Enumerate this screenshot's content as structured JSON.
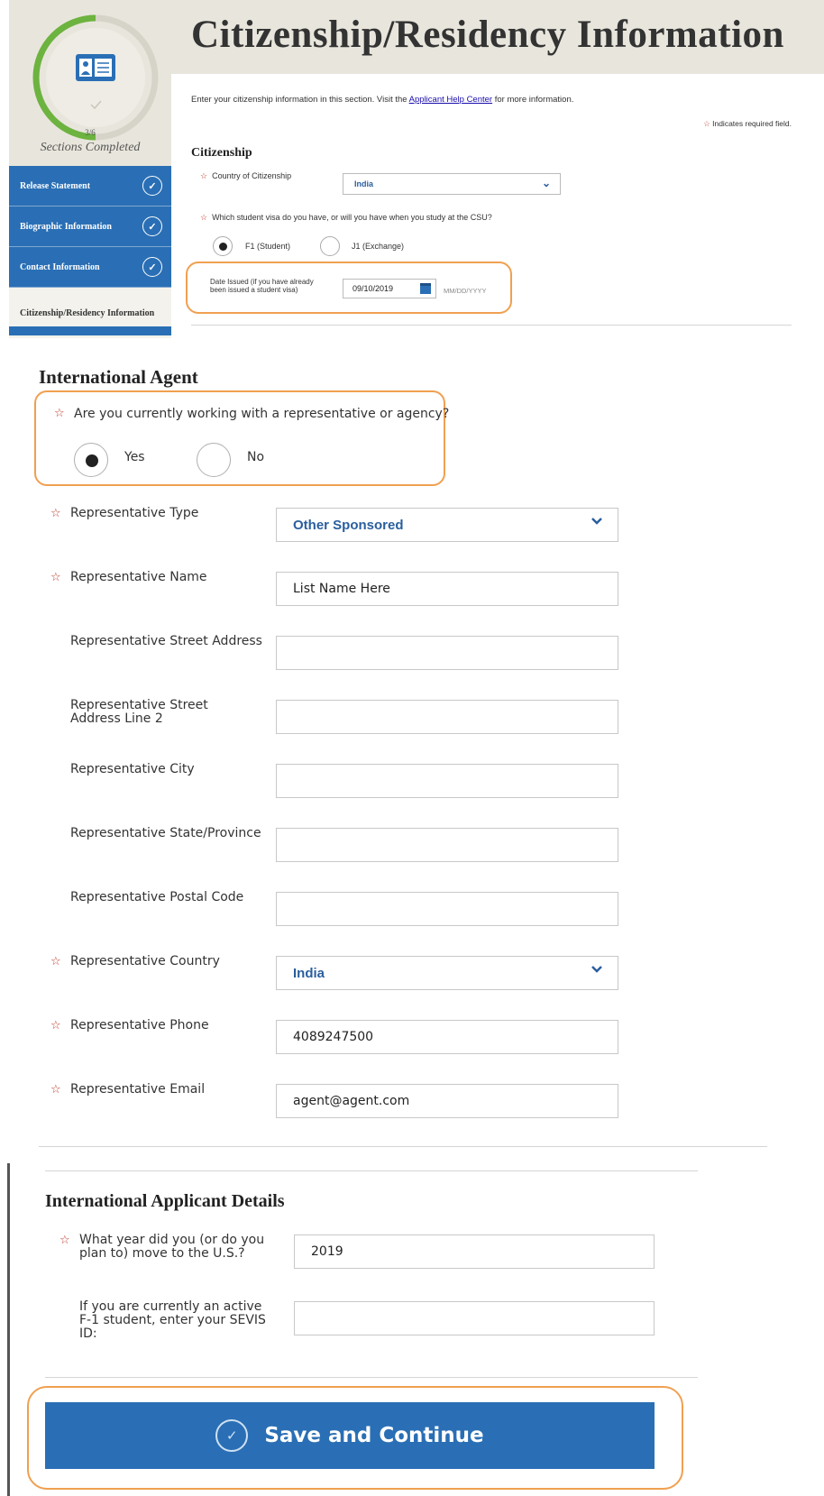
{
  "page": {
    "title": "Citizenship/Residency Information",
    "intro_before_link": "Enter your citizenship information in this section. Visit the ",
    "intro_link": "Applicant Help Center",
    "intro_after_link": " for more information.",
    "required_note": "Indicates required field."
  },
  "progress": {
    "count": "3/6",
    "label": "Sections Completed",
    "fraction_completed": 0.5
  },
  "sidebar": {
    "items": [
      {
        "label": "Release Statement",
        "completed": true
      },
      {
        "label": "Biographic Information",
        "completed": true
      },
      {
        "label": "Contact Information",
        "completed": true
      },
      {
        "label": "Citizenship/Residency Information",
        "completed": false
      }
    ]
  },
  "citizenship": {
    "heading": "Citizenship",
    "country_label": "Country of Citizenship",
    "country_value": "India",
    "visa_question": "Which student visa do you have, or will you have when you study at the CSU?",
    "visa_options": [
      "F1 (Student)",
      "J1 (Exchange)"
    ],
    "visa_selected": "F1 (Student)",
    "date_label": "Date Issued (if you have already been issued a student visa)",
    "date_value": "09/10/2019",
    "date_format": "MM/DD/YYYY"
  },
  "agent": {
    "heading": "International Agent",
    "question": "Are you currently working with a representative or agency?",
    "options": [
      "Yes",
      "No"
    ],
    "selected": "Yes",
    "fields": {
      "type": {
        "label": "Representative Type",
        "value": "Other Sponsored"
      },
      "name": {
        "label": "Representative Name",
        "value": "List Name Here"
      },
      "street": {
        "label": "Representative Street Address",
        "value": ""
      },
      "street2": {
        "label": "Representative Street Address Line 2",
        "value": ""
      },
      "city": {
        "label": "Representative City",
        "value": ""
      },
      "state": {
        "label": "Representative State/Province",
        "value": ""
      },
      "postal": {
        "label": "Representative Postal Code",
        "value": ""
      },
      "country": {
        "label": "Representative Country",
        "value": "India"
      },
      "phone": {
        "label": "Representative Phone",
        "value": "4089247500"
      },
      "email": {
        "label": "Representative Email",
        "value": "agent@agent.com"
      }
    }
  },
  "applicant": {
    "heading": "International Applicant Details",
    "year_label": "What year did you (or do you plan to) move to the U.S.?",
    "year_value": "2019",
    "sevis_label": "If you are currently an active F-1 student, enter your SEVIS ID:",
    "sevis_value": ""
  },
  "actions": {
    "save_label": "Save and Continue"
  },
  "colors": {
    "primary_blue": "#2a6fb5",
    "highlight_orange": "#f0a050",
    "progress_green": "#6db33f",
    "required_star": "#c0392b"
  }
}
